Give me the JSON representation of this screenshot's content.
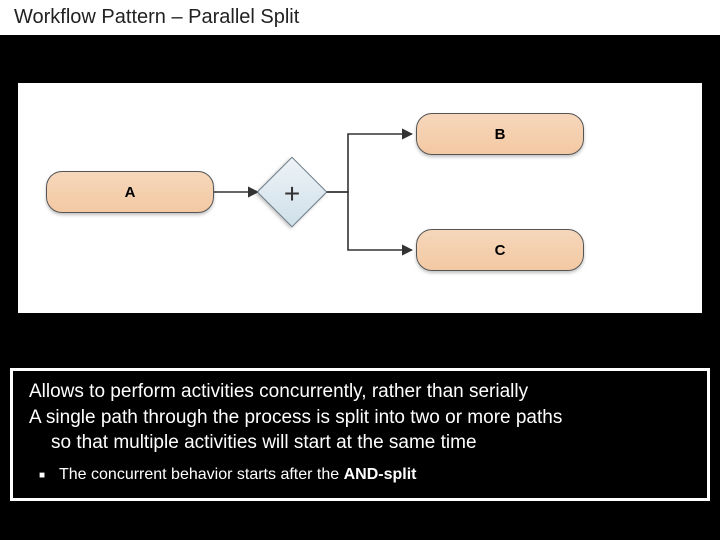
{
  "title": "Workflow Pattern – Parallel Split",
  "nodes": {
    "a": "A",
    "b": "B",
    "c": "C"
  },
  "gateway_symbol": "+",
  "description": {
    "line1": "Allows to perform activities concurrently, rather than serially",
    "line2a": "A single path through the process is split into two or more paths",
    "line2b": "so that multiple activities will start at the same time",
    "sub1_pre": "The concurrent behavior starts after the ",
    "sub1_bold": "AND-split"
  }
}
